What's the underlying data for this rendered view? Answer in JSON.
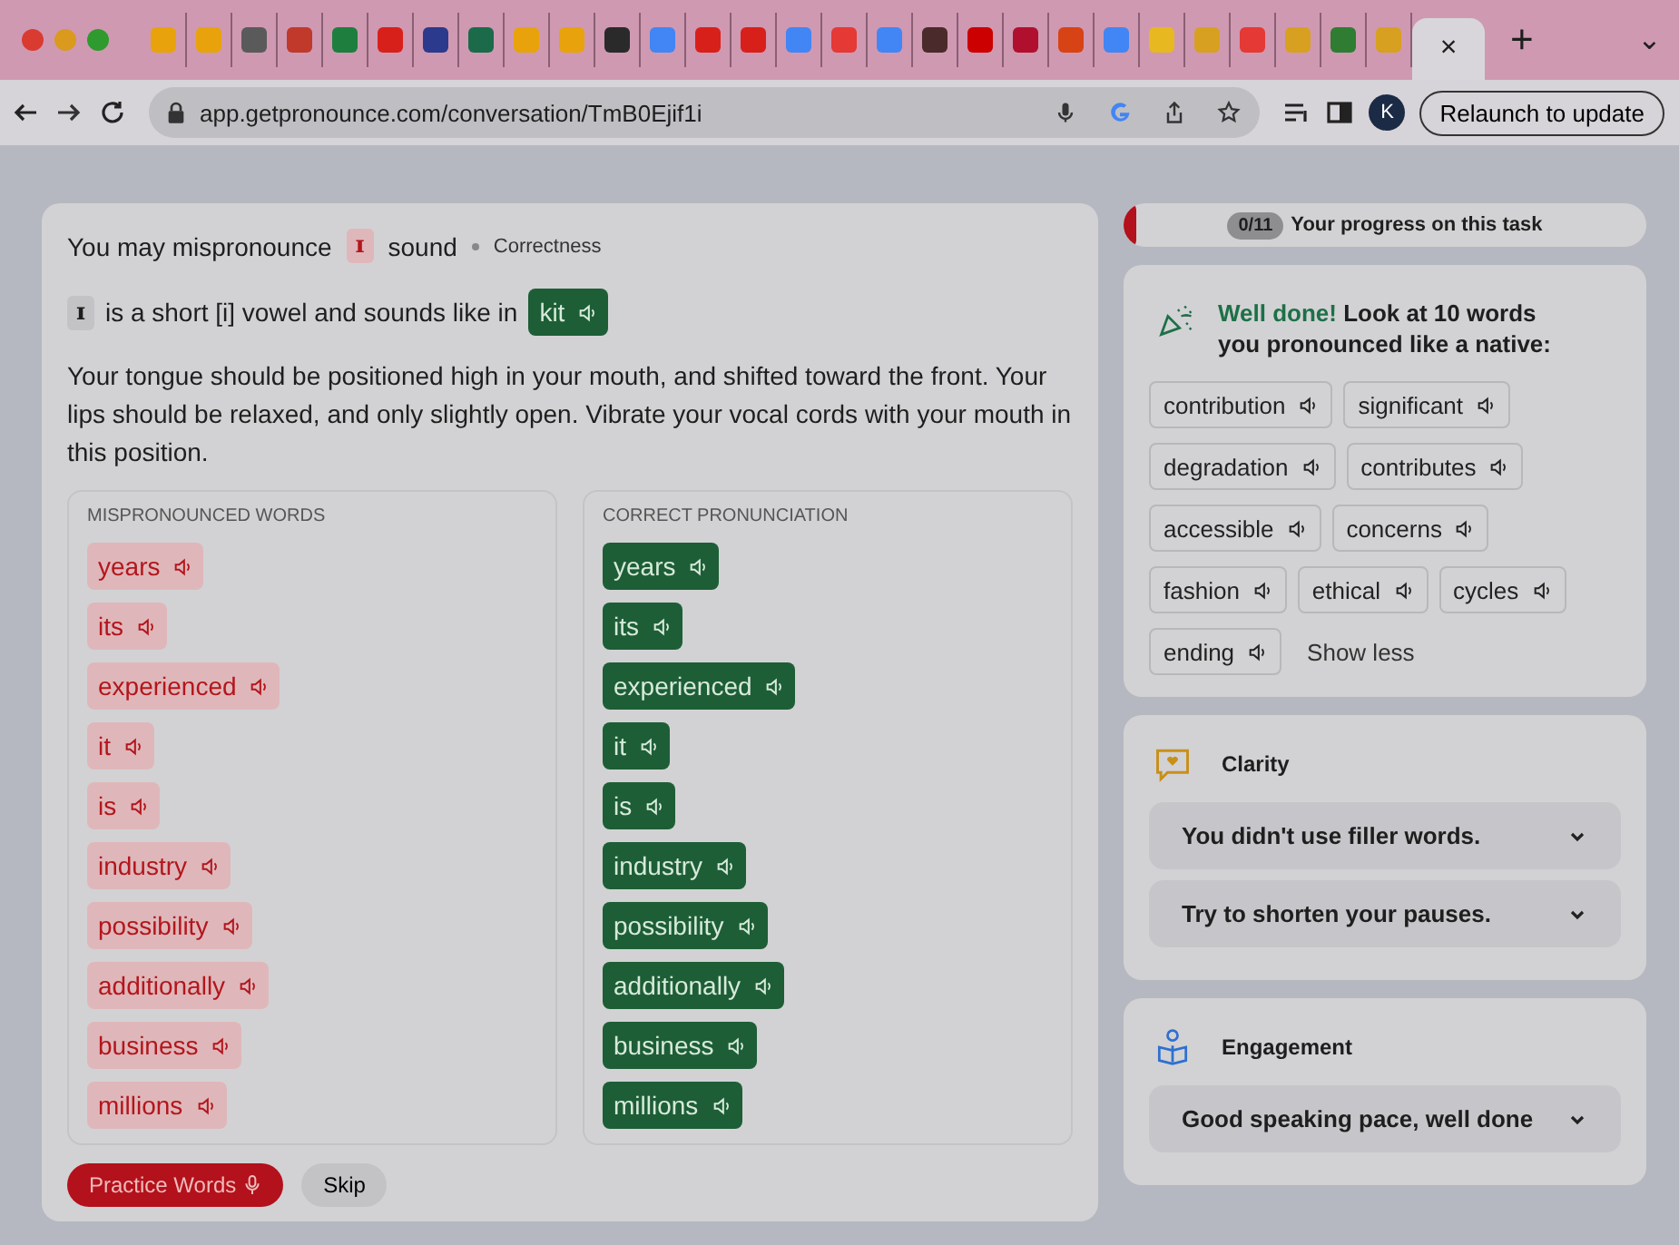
{
  "browser": {
    "tabs": [
      {
        "color": "#e8a30c",
        "selected": false
      },
      {
        "color": "#e8a30c",
        "selected": false
      },
      {
        "color": "#5a5a5a",
        "selected": false
      },
      {
        "color": "#c0392b",
        "selected": false
      },
      {
        "color": "#1e7e3e",
        "selected": false
      },
      {
        "color": "#d8201a",
        "selected": false
      },
      {
        "color": "#2b3a8c",
        "selected": false
      },
      {
        "color": "#1b6b4a",
        "selected": false
      },
      {
        "color": "#e8a30c",
        "selected": false
      },
      {
        "color": "#e8a30c",
        "selected": false
      },
      {
        "color": "#2a2a2a",
        "selected": false
      },
      {
        "color": "#4285f4",
        "selected": false
      },
      {
        "color": "#d8201a",
        "selected": false
      },
      {
        "color": "#d8201a",
        "selected": false
      },
      {
        "color": "#4285f4",
        "selected": false
      },
      {
        "color": "#e53935",
        "selected": false
      },
      {
        "color": "#4285f4",
        "selected": false
      },
      {
        "color": "#4a2a2a",
        "selected": false
      },
      {
        "color": "#cc0000",
        "selected": false
      },
      {
        "color": "#b0102e",
        "selected": false
      },
      {
        "color": "#d84315",
        "selected": false
      },
      {
        "color": "#4285f4",
        "selected": false
      },
      {
        "color": "#e8b820",
        "selected": false
      },
      {
        "color": "#d8a020",
        "selected": false
      },
      {
        "color": "#e53935",
        "selected": false
      },
      {
        "color": "#d8a020",
        "selected": false
      },
      {
        "color": "#2e7d32",
        "selected": false
      },
      {
        "color": "#d8a020",
        "selected": false
      },
      {
        "selected": true
      }
    ],
    "close_glyph": "×",
    "new_tab": "+",
    "tab_menu": "⌄",
    "url": "app.getpronounce.com/conversation/TmB0Ejif1i",
    "profile_initial": "K",
    "relaunch_button": "Relaunch to update"
  },
  "issue": {
    "prefix": "You may mispronounce",
    "sound": "ɪ",
    "suffix": "sound",
    "category": "Correctness",
    "symbol": "ɪ",
    "explanation": "is a short [i] vowel and sounds like in",
    "example": "kit",
    "description": "Your tongue should be positioned high in your mouth, and shifted toward the front. Your lips should be relaxed, and only slightly open. Vibrate your vocal cords with your mouth in this position.",
    "mispronounced": {
      "heading": "MISPRONOUNCED WORDS",
      "words": [
        "years",
        "its",
        "experienced",
        "it",
        "is",
        "industry",
        "possibility",
        "additionally",
        "business",
        "millions"
      ]
    },
    "correct": {
      "heading": "CORRECT PRONUNCIATION",
      "words": [
        "years",
        "its",
        "experienced",
        "it",
        "is",
        "industry",
        "possibility",
        "additionally",
        "business",
        "millions"
      ]
    },
    "practice_button": "Practice Words",
    "skip_button": "Skip"
  },
  "progress": {
    "count": "0/11",
    "label": "Your progress on this task",
    "level": 0
  },
  "well_done": {
    "highlight": "Well done!",
    "text": "Look at 10 words you pronounced like a native:",
    "words": [
      "contribution",
      "significant",
      "degradation",
      "contributes",
      "accessible",
      "concerns",
      "fashion",
      "ethical",
      "cycles",
      "ending"
    ],
    "toggle": "Show less"
  },
  "clarity": {
    "title": "Clarity",
    "items": [
      {
        "text": "You didn't use filler words.",
        "expanded": false
      },
      {
        "text": "Try to shorten your pauses.",
        "expanded": false
      }
    ]
  },
  "engagement": {
    "title": "Engagement",
    "items": [
      {
        "text": "Good speaking pace, well done",
        "expanded": false
      }
    ]
  }
}
